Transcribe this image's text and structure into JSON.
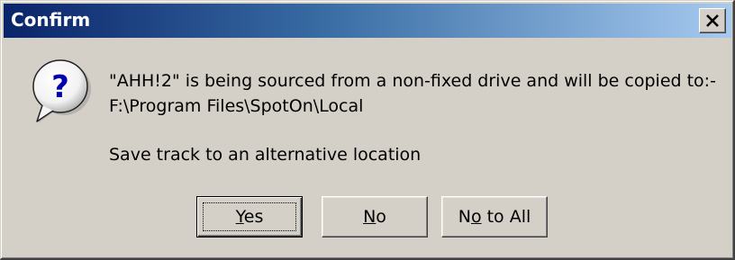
{
  "window": {
    "title": "Confirm",
    "close_symbol": "×"
  },
  "message": {
    "icon": "question-icon",
    "line1": "\"AHH!2\" is being sourced from a non-fixed drive and will be copied to:-",
    "line2": "F:\\Program Files\\SpotOn\\Local",
    "line3": "Save track to an alternative location"
  },
  "buttons": {
    "yes": {
      "label": "Yes",
      "mnemonic": "Y",
      "rest": "es"
    },
    "no": {
      "label": "No",
      "mnemonic": "N",
      "rest": "o"
    },
    "no_to_all": {
      "label": "No to All",
      "pre": "N",
      "mnemonic": "o",
      "rest": " to All"
    }
  },
  "colors": {
    "title_gradient_start": "#0a246a",
    "title_gradient_end": "#a6caf0",
    "face": "#d4d0c8"
  }
}
